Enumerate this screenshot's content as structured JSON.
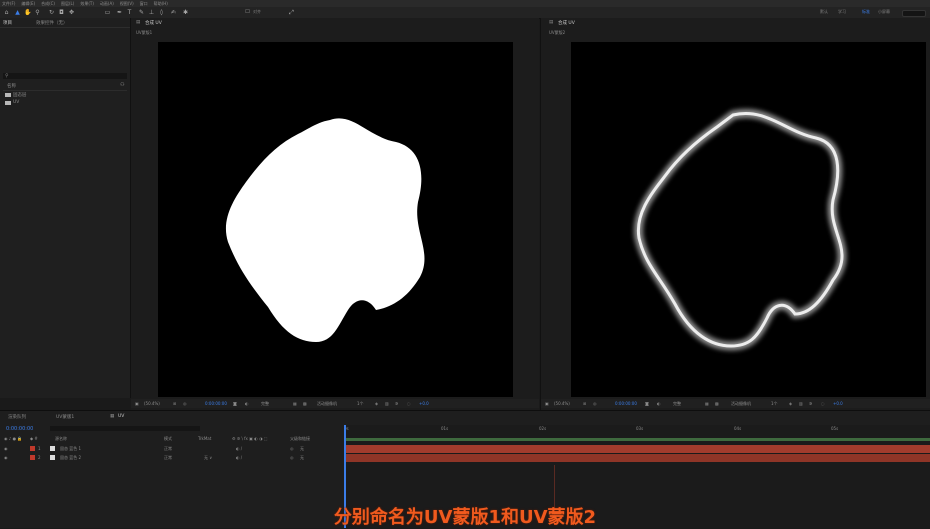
{
  "colors": {
    "accent": "#3b7de8",
    "caption": "#f05a1e",
    "layer_bar": "#a23c2d",
    "work_area": "#3e6a3e",
    "layer_label": "#c0392b"
  },
  "menubar": {
    "items": [
      "文件(F)",
      "编辑(E)",
      "合成(C)",
      "图层(L)",
      "效果(T)",
      "动画(A)",
      "视图(V)",
      "窗口",
      "帮助(H)"
    ]
  },
  "toolbar": {
    "tools": [
      "home-icon",
      "selection-tool-icon",
      "hand-tool-icon",
      "zoom-tool-icon",
      "rotate-tool-icon",
      "camera-tool-icon",
      "pan-behind-tool-icon",
      "rectangle-tool-icon",
      "pen-tool-icon",
      "type-tool-icon",
      "brush-tool-icon",
      "clone-stamp-icon",
      "eraser-icon",
      "roto-brush-icon",
      "puppet-pin-icon"
    ],
    "snap_label": "对齐",
    "workspaces": [
      "默认",
      "学习",
      "标准",
      "小屏幕"
    ]
  },
  "project": {
    "tabs": [
      "项目",
      "效果控件（无）"
    ],
    "list_header": "名称",
    "items": [
      "固态层",
      "UV"
    ]
  },
  "viewer_left": {
    "tab": "合成 UV",
    "subtab": "UV蒙版1",
    "zoom": "(50.4%)",
    "timecode": "0:00:00:00",
    "resolution": "完整",
    "view": "活动摄像机",
    "views": "1个",
    "offset": "+0.0"
  },
  "viewer_right": {
    "tab": "合成 UV",
    "subtab": "UV蒙版2",
    "zoom": "(50.4%)",
    "timecode": "0:00:00:00",
    "resolution": "完整",
    "view": "活动摄像机",
    "views": "1个",
    "offset": "+0.0"
  },
  "timeline": {
    "tabs": [
      "渲染队列",
      "UV蒙版1",
      "UV"
    ],
    "current_time": "0:00:00:00",
    "columns": {
      "layer_name": "源名称",
      "mode": "模式",
      "trkmat": "TrkMat",
      "parent": "父级和链接"
    },
    "layers": [
      {
        "index": "1",
        "name": "固态 蓝色 1",
        "mode": "正常",
        "parent": "无"
      },
      {
        "index": "2",
        "name": "固态 蓝色 2",
        "mode": "正常",
        "parent": "无"
      }
    ],
    "ruler_ticks": [
      "0s",
      "01s",
      "02s",
      "03s",
      "04s",
      "05s"
    ]
  },
  "caption": "分别命名为UV蒙版1和UV蒙版2"
}
